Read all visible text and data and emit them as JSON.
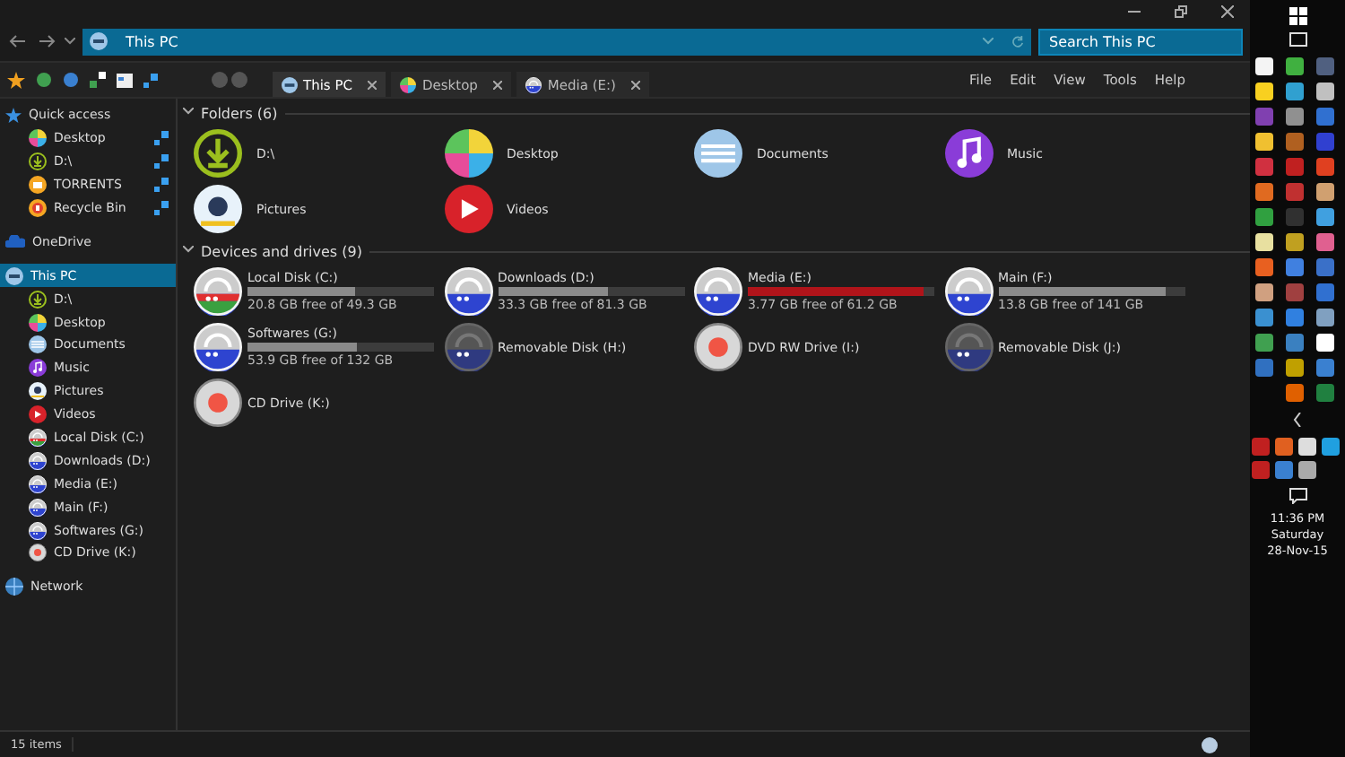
{
  "address": {
    "path": "This PC"
  },
  "search": {
    "placeholder": "Search This PC"
  },
  "tabs": [
    {
      "label": "This PC",
      "kind": "pc",
      "selected": true
    },
    {
      "label": "Desktop",
      "kind": "desktop",
      "selected": false
    },
    {
      "label": "Media (E:)",
      "kind": "disk",
      "selected": false
    }
  ],
  "menu": [
    "File",
    "Edit",
    "View",
    "Tools",
    "Help"
  ],
  "sidebar": {
    "quick_access": {
      "label": "Quick access",
      "items": [
        {
          "label": "Desktop",
          "kind": "desktop",
          "pinned": true
        },
        {
          "label": "D:\\",
          "kind": "download",
          "pinned": true
        },
        {
          "label": "TORRENTS",
          "kind": "folder",
          "pinned": true
        },
        {
          "label": "Recycle Bin",
          "kind": "recycle",
          "pinned": true
        }
      ]
    },
    "onedrive": {
      "label": "OneDrive"
    },
    "this_pc": {
      "label": "This PC",
      "selected": true,
      "children": [
        {
          "label": "D:\\",
          "kind": "download"
        },
        {
          "label": "Desktop",
          "kind": "desktop"
        },
        {
          "label": "Documents",
          "kind": "documents"
        },
        {
          "label": "Music",
          "kind": "music"
        },
        {
          "label": "Pictures",
          "kind": "pictures"
        },
        {
          "label": "Videos",
          "kind": "videos"
        },
        {
          "label": "Local Disk (C:)",
          "kind": "system"
        },
        {
          "label": "Downloads (D:)",
          "kind": "disk"
        },
        {
          "label": "Media (E:)",
          "kind": "disk"
        },
        {
          "label": "Main (F:)",
          "kind": "disk"
        },
        {
          "label": "Softwares (G:)",
          "kind": "disk"
        },
        {
          "label": "CD Drive (K:)",
          "kind": "optical"
        }
      ]
    },
    "network": {
      "label": "Network"
    }
  },
  "folders": {
    "title": "Folders (6)",
    "expanded": true,
    "items": [
      {
        "label": "D:\\",
        "kind": "download"
      },
      {
        "label": "Desktop",
        "kind": "desktop"
      },
      {
        "label": "Documents",
        "kind": "documents"
      },
      {
        "label": "Music",
        "kind": "music"
      },
      {
        "label": "Pictures",
        "kind": "pictures"
      },
      {
        "label": "Videos",
        "kind": "videos"
      }
    ]
  },
  "drives": {
    "title": "Devices and drives (9)",
    "expanded": true,
    "items": [
      {
        "name": "Local Disk (C:)",
        "kind": "system",
        "level": 0.58,
        "low_space": false,
        "free": "20.8 GB free of 49.3 GB"
      },
      {
        "name": "Downloads (D:)",
        "kind": "disk",
        "level": 0.59,
        "low_space": false,
        "free": "33.3 GB free of 81.3 GB"
      },
      {
        "name": "Media (E:)",
        "kind": "disk",
        "level": 0.94,
        "low_space": true,
        "free": "3.77 GB free of 61.2 GB"
      },
      {
        "name": "Main (F:)",
        "kind": "disk",
        "level": 0.9,
        "low_space": false,
        "free": "13.8 GB free of 141 GB"
      },
      {
        "name": "Softwares (G:)",
        "kind": "disk",
        "level": 0.59,
        "low_space": false,
        "free": "53.9 GB free of 132 GB"
      },
      {
        "name": "Removable Disk (H:)",
        "kind": "removable"
      },
      {
        "name": "DVD RW Drive (I:)",
        "kind": "optical"
      },
      {
        "name": "Removable Disk (J:)",
        "kind": "removable"
      },
      {
        "name": "CD Drive (K:)",
        "kind": "optical"
      }
    ]
  },
  "status_bar": {
    "count": "15 items"
  },
  "clock": {
    "time": "11:36 PM",
    "day": "Saturday",
    "date": "28-Nov-15"
  }
}
